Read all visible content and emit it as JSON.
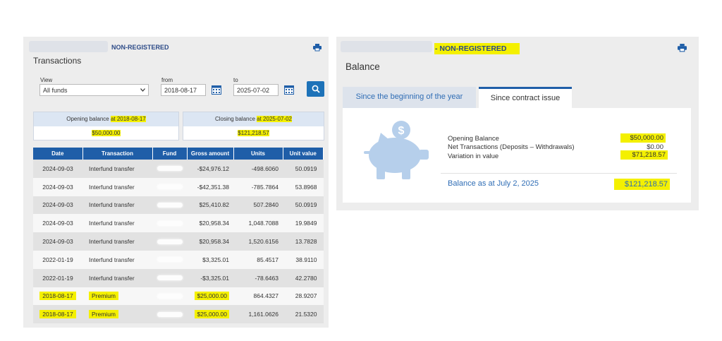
{
  "left_panel": {
    "account_type": "NON-REGISTERED",
    "title": "Transactions",
    "view_label": "View",
    "view_value": "All funds",
    "from_label": "from",
    "from_value": "2018-08-17",
    "to_label": "to",
    "to_value": "2025-07-02",
    "opening_label_prefix": "Opening balance ",
    "opening_label_date": "at 2018-08-17",
    "opening_value": "$50,000.00",
    "closing_label_prefix": "Closing balance ",
    "closing_label_date": "at 2025-07-02",
    "closing_value": "$121,218.57",
    "columns": [
      "Date",
      "Transaction",
      "Fund",
      "Gross amount",
      "Units",
      "Unit value"
    ],
    "rows": [
      {
        "date": "2024-09-03",
        "transaction": "Interfund transfer",
        "gross": "-$24,976.12",
        "units": "-498.6060",
        "unit_value": "50.0919",
        "highlight": false
      },
      {
        "date": "2024-09-03",
        "transaction": "Interfund transfer",
        "gross": "-$42,351.38",
        "units": "-785.7864",
        "unit_value": "53.8968",
        "highlight": false
      },
      {
        "date": "2024-09-03",
        "transaction": "Interfund transfer",
        "gross": "$25,410.82",
        "units": "507.2840",
        "unit_value": "50.0919",
        "highlight": false
      },
      {
        "date": "2024-09-03",
        "transaction": "Interfund transfer",
        "gross": "$20,958.34",
        "units": "1,048.7088",
        "unit_value": "19.9849",
        "highlight": false
      },
      {
        "date": "2024-09-03",
        "transaction": "Interfund transfer",
        "gross": "$20,958.34",
        "units": "1,520.6156",
        "unit_value": "13.7828",
        "highlight": false
      },
      {
        "date": "2022-01-19",
        "transaction": "Interfund transfer",
        "gross": "$3,325.01",
        "units": "85.4517",
        "unit_value": "38.9110",
        "highlight": false
      },
      {
        "date": "2022-01-19",
        "transaction": "Interfund transfer",
        "gross": "-$3,325.01",
        "units": "-78.6463",
        "unit_value": "42.2780",
        "highlight": false
      },
      {
        "date": "2018-08-17",
        "transaction": "Premium",
        "gross": "$25,000.00",
        "units": "864.4327",
        "unit_value": "28.9207",
        "highlight": true
      },
      {
        "date": "2018-08-17",
        "transaction": "Premium",
        "gross": "$25,000.00",
        "units": "1,161.0626",
        "unit_value": "21.5320",
        "highlight": true
      }
    ]
  },
  "right_panel": {
    "account_type": "- NON-REGISTERED",
    "title": "Balance",
    "tabs": [
      "Since the beginning of the year",
      "Since contract issue"
    ],
    "active_tab": 1,
    "items": [
      {
        "label": "Opening Balance",
        "value": "$50,000.00"
      },
      {
        "label": "Net Transactions (Deposits – Withdrawals)",
        "value": "$0.00"
      },
      {
        "label": "Variation in value",
        "value": "$71,218.57"
      }
    ],
    "total_label": "Balance as at July 2, 2025",
    "total_value": "$121,218.57"
  },
  "colors": {
    "accent_blue": "#1f5ea8",
    "highlight_yellow": "#f4f000",
    "link_blue": "#2f6db5"
  },
  "icons": [
    "print-icon",
    "calendar-icon",
    "search-icon",
    "piggy-bank-icon",
    "chevron-down-icon"
  ]
}
